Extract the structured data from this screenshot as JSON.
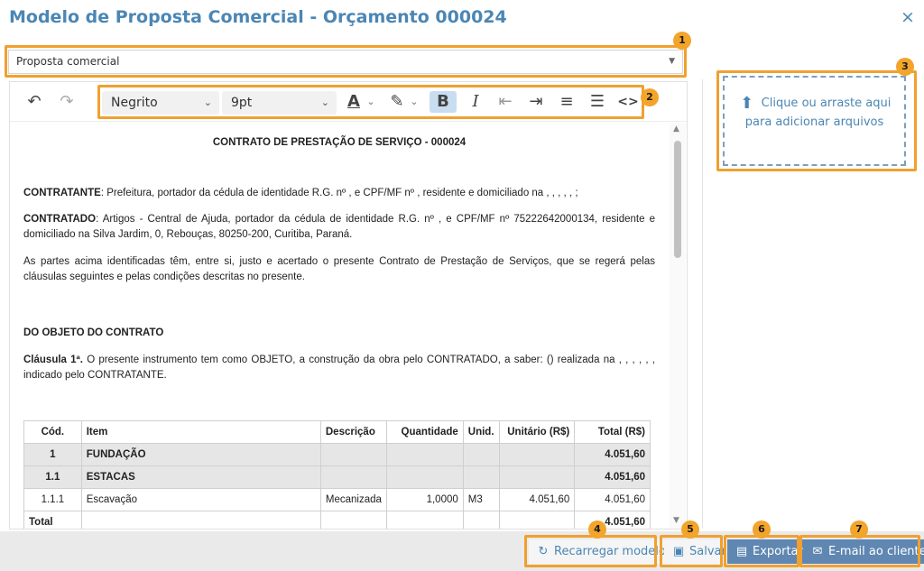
{
  "dialog": {
    "title": "Modelo de Proposta Comercial - Orçamento 000024",
    "close_icon": "×"
  },
  "model_select": {
    "value": "Proposta comercial"
  },
  "toolbar": {
    "undo": "↶",
    "redo": "↷",
    "font_style": "Negrito",
    "font_size": "9pt",
    "text_color": "A",
    "highlight": "✎",
    "bold": "B",
    "italic": "I",
    "outdent": "⇤",
    "indent": "⇥",
    "ordered_list": "≡",
    "bullet_list": "☰",
    "code": "<>"
  },
  "document": {
    "heading": "CONTRATO DE PRESTAÇÃO DE SERVIÇO - 000024",
    "contratante_label": "CONTRATANTE",
    "contratante_text": ": Prefeitura, portador da cédula de identidade R.G. nº , e CPF/MF nº , residente e domiciliado na , , , , , ;",
    "contratado_label": "CONTRATADO",
    "contratado_text": ": Artigos - Central de Ajuda, portador da cédula de identidade R.G. nº , e CPF/MF nº 75222642000134, residente e domiciliado na Silva Jardim, 0, Rebouças, 80250-200, Curitiba, Paraná.",
    "partes_text": "As partes acima identificadas têm, entre si, justo e acertado o presente Contrato de Prestação de Serviços, que se regerá pelas cláusulas seguintes e pelas condições descritas no presente.",
    "objeto_heading": "DO OBJETO DO CONTRATO",
    "clausula_label": "Cláusula 1ª.",
    "clausula_text": " O presente instrumento tem como OBJETO, a construção da obra pelo CONTRATADO, a saber: () realizada na , , , , , , indicado pelo CONTRATANTE."
  },
  "table": {
    "headers": [
      "Cód.",
      "Item",
      "Descrição",
      "Quantidade",
      "Unid.",
      "Unitário (R$)",
      "Total (R$)"
    ],
    "rows": [
      {
        "group": true,
        "cells": [
          "1",
          "FUNDAÇÃO",
          "",
          "",
          "",
          "",
          "4.051,60"
        ]
      },
      {
        "group": true,
        "cells": [
          "1.1",
          "ESTACAS",
          "",
          "",
          "",
          "",
          "4.051,60"
        ]
      },
      {
        "group": false,
        "cells": [
          "1.1.1",
          "Escavação",
          "Mecanizada",
          "1,0000",
          "M3",
          "4.051,60",
          "4.051,60"
        ]
      },
      {
        "group": false,
        "cells": [
          "Total",
          "",
          "",
          "",
          "",
          "",
          "4.051,60"
        ]
      }
    ]
  },
  "upload": {
    "icon": "⬆",
    "label": "Clique ou arraste aqui para adicionar arquivos"
  },
  "footer": {
    "reload_icon": "↻",
    "reload_label": "Recarregar modelo",
    "save_icon": "▣",
    "save_label": "Salvar",
    "export_icon": "▤",
    "export_label": "Exportar",
    "email_icon": "✉",
    "email_label": "E-mail ao cliente"
  },
  "badges": [
    "1",
    "2",
    "3",
    "4",
    "5",
    "6",
    "7"
  ],
  "colors": {
    "accent": "#4b86b4",
    "highlight": "#f0a030",
    "dark_button": "#5f87b2"
  }
}
